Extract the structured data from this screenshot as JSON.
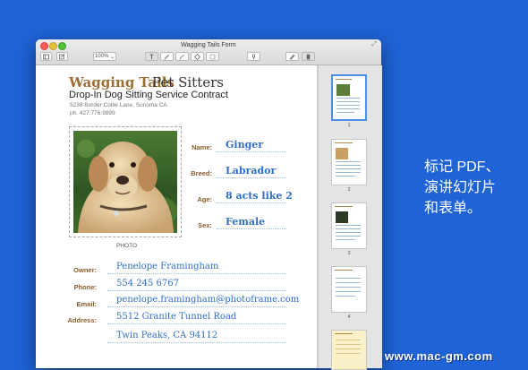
{
  "window": {
    "title": "Wagging Tails Form",
    "toolbar": {
      "zoom": "100%"
    }
  },
  "form": {
    "brand_bold": "Wagging Tails",
    "brand_regular": "Pet Sitters",
    "subtitle": "Drop-In Dog Sitting Service Contract",
    "address_line1": "5238 Border Collie Lane, Sonoma CA",
    "address_line2": "ph. 427.776.9899",
    "photo_caption": "PHOTO",
    "pet_fields": [
      {
        "label": "Name:",
        "value": "Ginger"
      },
      {
        "label": "Breed:",
        "value": "Labrador"
      },
      {
        "label": "Age:",
        "value": "8 acts like 2"
      },
      {
        "label": "Sex:",
        "value": "Female"
      }
    ],
    "owner_fields": [
      {
        "label": "Owner:",
        "value": "Penelope Framingham"
      },
      {
        "label": "Phone:",
        "value": "554 245 6767"
      },
      {
        "label": "Email:",
        "value": "penelope.framingham@photoframe.com"
      },
      {
        "label": "Address:",
        "value": "5512 Granite Tunnel Road"
      },
      {
        "label": "",
        "value": "Twin Peaks, CA 94112"
      }
    ]
  },
  "sidebar": {
    "page_numbers": [
      "1",
      "2",
      "3",
      "4"
    ]
  },
  "promo": {
    "line1": "标记 PDF、",
    "line2": "演讲幻灯片",
    "line3": "和表单。"
  },
  "watermark": "www.mac-gm.com"
}
